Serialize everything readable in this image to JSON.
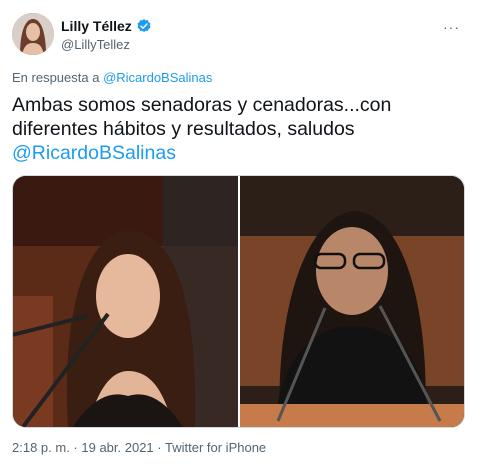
{
  "author": {
    "display_name": "Lilly Téllez",
    "handle": "@LillyTellez",
    "verified_icon": "verified-badge-icon",
    "avatar_icon": "avatar"
  },
  "more_label": "···",
  "reply": {
    "prefix": "En respuesta a ",
    "target": "@RicardoBSalinas"
  },
  "tweet": {
    "text_line1": "Ambas somos senadoras y cenadoras...con",
    "text_line2": "diferentes hábitos y resultados, saludos",
    "mention": "@RicardoBSalinas"
  },
  "meta": {
    "time": "2:18 p. m.",
    "sep1": " · ",
    "date": "19 abr. 2021",
    "sep2": " · ",
    "client": "Twitter for iPhone"
  },
  "colors": {
    "link": "#1d9bf0",
    "secondary_text": "#536471",
    "primary_text": "#0f1419",
    "border": "#cfd9de"
  }
}
